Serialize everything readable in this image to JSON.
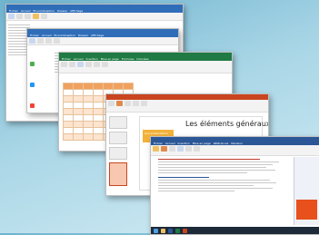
{
  "windows": {
    "outlook_back": {
      "tabs": [
        "Fichier",
        "Accueil",
        "Envoi/réception",
        "Dossier",
        "Affichage"
      ]
    },
    "outlook": {
      "tabs": [
        "Fichier",
        "Accueil",
        "Envoi/réception",
        "Dossier",
        "Affichage"
      ]
    },
    "excel": {
      "tabs": [
        "Fichier",
        "Accueil",
        "Insertion",
        "Mise en page",
        "Formules",
        "Données"
      ],
      "columns": [
        "",
        "",
        "",
        "",
        "",
        "",
        ""
      ]
    },
    "powerpoint": {
      "slide_title": "Les éléments généraux",
      "box_label": "Une présentation"
    },
    "word": {
      "tabs": [
        "Fichier",
        "Accueil",
        "Insertion",
        "Mise en page",
        "Références",
        "Révision"
      ]
    }
  },
  "colors": {
    "outlook": "#2f6db8",
    "excel": "#1f7a43",
    "powerpoint": "#c9451f",
    "word": "#2b5797",
    "accent_orange": "#f0a15e"
  }
}
